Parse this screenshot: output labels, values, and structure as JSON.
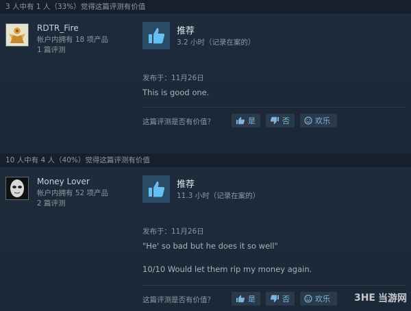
{
  "reviews": [
    {
      "helpful_text": "3 人中有 1 人（33%）觉得这篇评测有价值",
      "author_name": "RDTR_Fire",
      "products_owned": "帐户内拥有 18 项产品",
      "reviews_count": "1 篇评测",
      "avatar": "golden-figure-avatar",
      "recommendation": "推荐",
      "hours": "3.2 小时（记录在案的）",
      "posted": "发布于：11月26日",
      "text": [
        "This is good one."
      ],
      "vote_question": "这篇评测是否有价值？",
      "yes_label": "是",
      "no_label": "否",
      "funny_label": "欢乐"
    },
    {
      "helpful_text": "10 人中有 4 人（40%）觉得这篇评测有价值",
      "author_name": "Money Lover",
      "products_owned": "帐户内拥有 52 项产品",
      "reviews_count": "2 篇评测",
      "avatar": "masked-face-avatar",
      "recommendation": "推荐",
      "hours": "11.3 小时（记录在案的）",
      "posted": "发布于：11月26日",
      "text": [
        "\"He' so bad but he does it so well\"",
        "10/10 Would let them rip my money again."
      ],
      "vote_question": "这篇评测是否有价值？",
      "yes_label": "是",
      "no_label": "否",
      "funny_label": "欢乐"
    }
  ],
  "watermark": {
    "text": "当游网",
    "logo": "3HE"
  },
  "colors": {
    "background": "#1b2838",
    "accent": "#66c0f4",
    "thumb_box": "#2a4a66"
  }
}
